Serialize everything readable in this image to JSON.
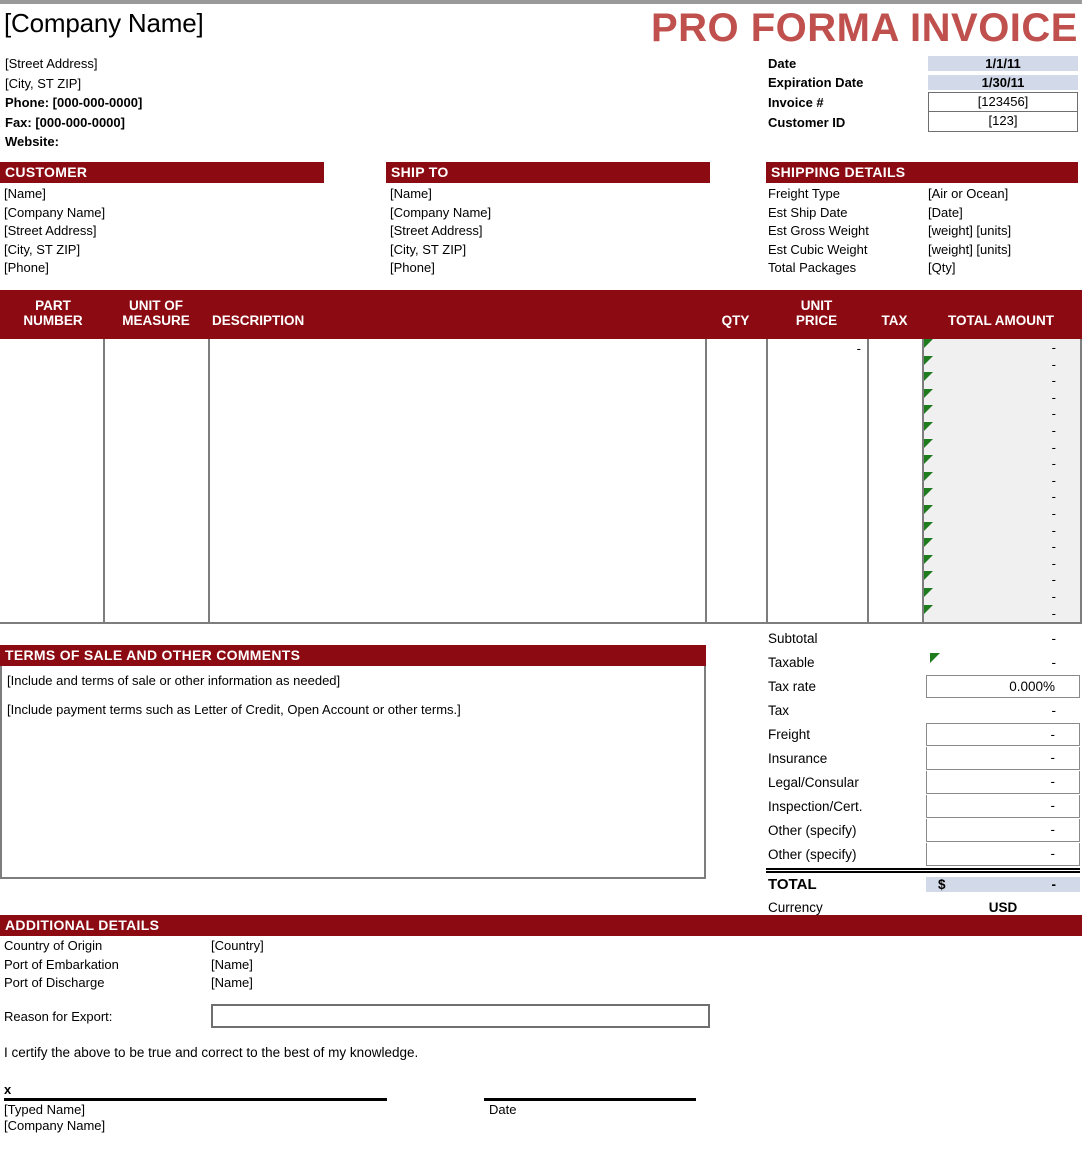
{
  "header": {
    "company_name": "[Company Name]",
    "street_address": "[Street Address]",
    "city_state_zip": "[City, ST  ZIP]",
    "phone": "Phone: [000-000-0000]",
    "fax": "Fax: [000-000-0000]",
    "website": "Website:",
    "doc_title": "PRO FORMA INVOICE",
    "meta": {
      "date_label": "Date",
      "date_value": "1/1/11",
      "expiration_label": "Expiration Date",
      "expiration_value": "1/30/11",
      "invoice_label": "Invoice #",
      "invoice_value": "[123456]",
      "customer_id_label": "Customer ID",
      "customer_id_value": "[123]"
    }
  },
  "customer": {
    "title": "CUSTOMER",
    "name": "[Name]",
    "company": "[Company Name]",
    "street": "[Street Address]",
    "city": "[City, ST  ZIP]",
    "phone": "[Phone]"
  },
  "ship_to": {
    "title": "SHIP TO",
    "name": "[Name]",
    "company": "[Company Name]",
    "street": "[Street Address]",
    "city": "[City, ST  ZIP]",
    "phone": "[Phone]"
  },
  "shipping_details": {
    "title": "SHIPPING DETAILS",
    "rows": [
      {
        "key": "Freight Type",
        "value": "[Air or Ocean]"
      },
      {
        "key": "Est Ship Date",
        "value": "[Date]"
      },
      {
        "key": "Est Gross Weight",
        "value": "[weight] [units]"
      },
      {
        "key": "Est Cubic Weight",
        "value": "[weight] [units]"
      },
      {
        "key": "Total Packages",
        "value": "[Qty]"
      }
    ]
  },
  "items_table": {
    "columns": {
      "part_number_line1": "PART",
      "part_number_line2": "NUMBER",
      "unit_of_measure_line1": "UNIT OF",
      "unit_of_measure_line2": "MEASURE",
      "description": "DESCRIPTION",
      "qty": "QTY",
      "unit_price_line1": "UNIT",
      "unit_price_line2": "PRICE",
      "tax": "TAX",
      "total_amount": "TOTAL AMOUNT"
    },
    "unit_price_first_row": "-",
    "row_count": 17,
    "row_amount_value": "-"
  },
  "terms": {
    "title": "TERMS OF SALE AND OTHER COMMENTS",
    "line1": "[Include and terms of sale or other information as needed]",
    "line2": "[Include payment terms such as Letter of Credit, Open Account or other terms.]"
  },
  "totals": {
    "subtotal_label": "Subtotal",
    "subtotal_value": "-",
    "taxable_label": "Taxable",
    "taxable_value": "-",
    "tax_rate_label": "Tax rate",
    "tax_rate_value": "0.000%",
    "tax_label": "Tax",
    "tax_value": "-",
    "freight_label": "Freight",
    "freight_value": "-",
    "insurance_label": "Insurance",
    "insurance_value": "-",
    "legal_label": "Legal/Consular",
    "legal_value": "-",
    "inspection_label": "Inspection/Cert.",
    "inspection_value": "-",
    "other1_label": "Other (specify)",
    "other1_value": "-",
    "other2_label": "Other (specify)",
    "other2_value": "-",
    "total_label": "TOTAL",
    "total_currency_symbol": "$",
    "total_value": "-",
    "currency_label": "Currency",
    "currency_value": "USD"
  },
  "additional_details": {
    "title": "ADDITIONAL DETAILS",
    "rows": [
      {
        "key": "Country of Origin",
        "value": "[Country]"
      },
      {
        "key": "Port of Embarkation",
        "value": "[Name]"
      },
      {
        "key": "Port of Discharge",
        "value": "[Name]"
      }
    ],
    "reason_label": "Reason for Export:",
    "reason_value": ""
  },
  "signature": {
    "certify_text": "I certify the above to be true and correct to the best of my knowledge.",
    "x_mark": "x",
    "typed_name": "[Typed Name]",
    "company_name": "[Company Name]",
    "date_label": "Date"
  },
  "colors": {
    "bar_red": "#8C0B12",
    "title_red": "#C0504D",
    "shade_blue": "#D2D9E8",
    "total_col_gray": "#F0F0F0",
    "flag_green": "#1E7B1E",
    "border_gray": "#7D7D7D"
  }
}
